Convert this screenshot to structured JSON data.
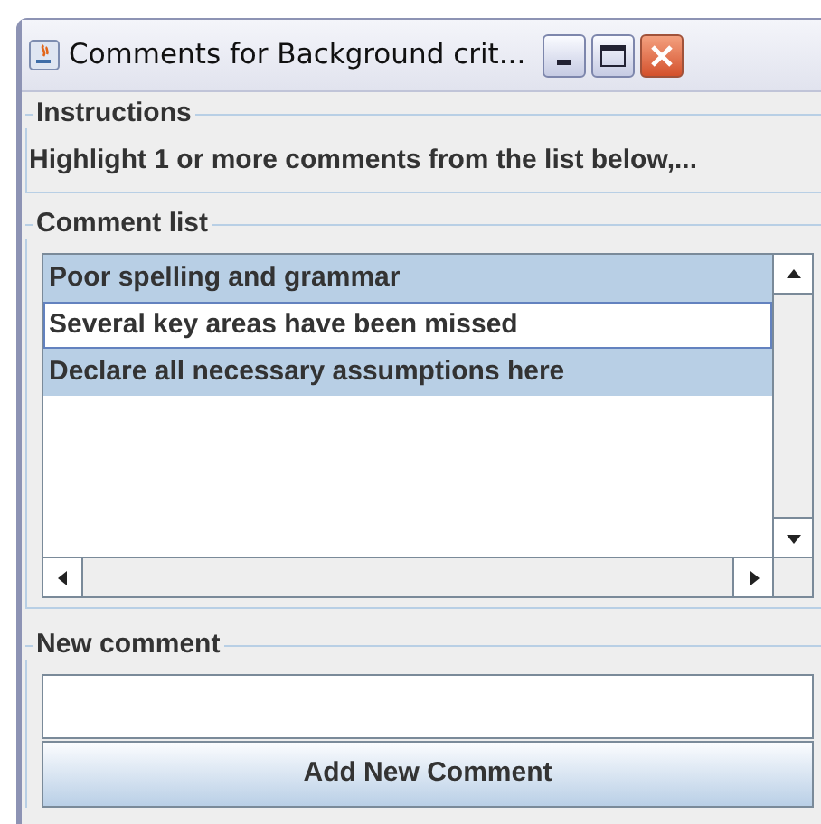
{
  "window": {
    "title": "Comments for Background crit..."
  },
  "instructions": {
    "legend": "Instructions",
    "text": "Highlight 1 or more comments from the list below,..."
  },
  "comment_list": {
    "legend": "Comment list",
    "items": [
      {
        "text": "Poor spelling and grammar",
        "selected": true,
        "focused": false
      },
      {
        "text": "Several key areas have been missed",
        "selected": false,
        "focused": true
      },
      {
        "text": "Declare all necessary assumptions here",
        "selected": true,
        "focused": false
      }
    ]
  },
  "new_comment": {
    "legend": "New comment"
  },
  "add_button": {
    "label": "Add New Comment"
  }
}
